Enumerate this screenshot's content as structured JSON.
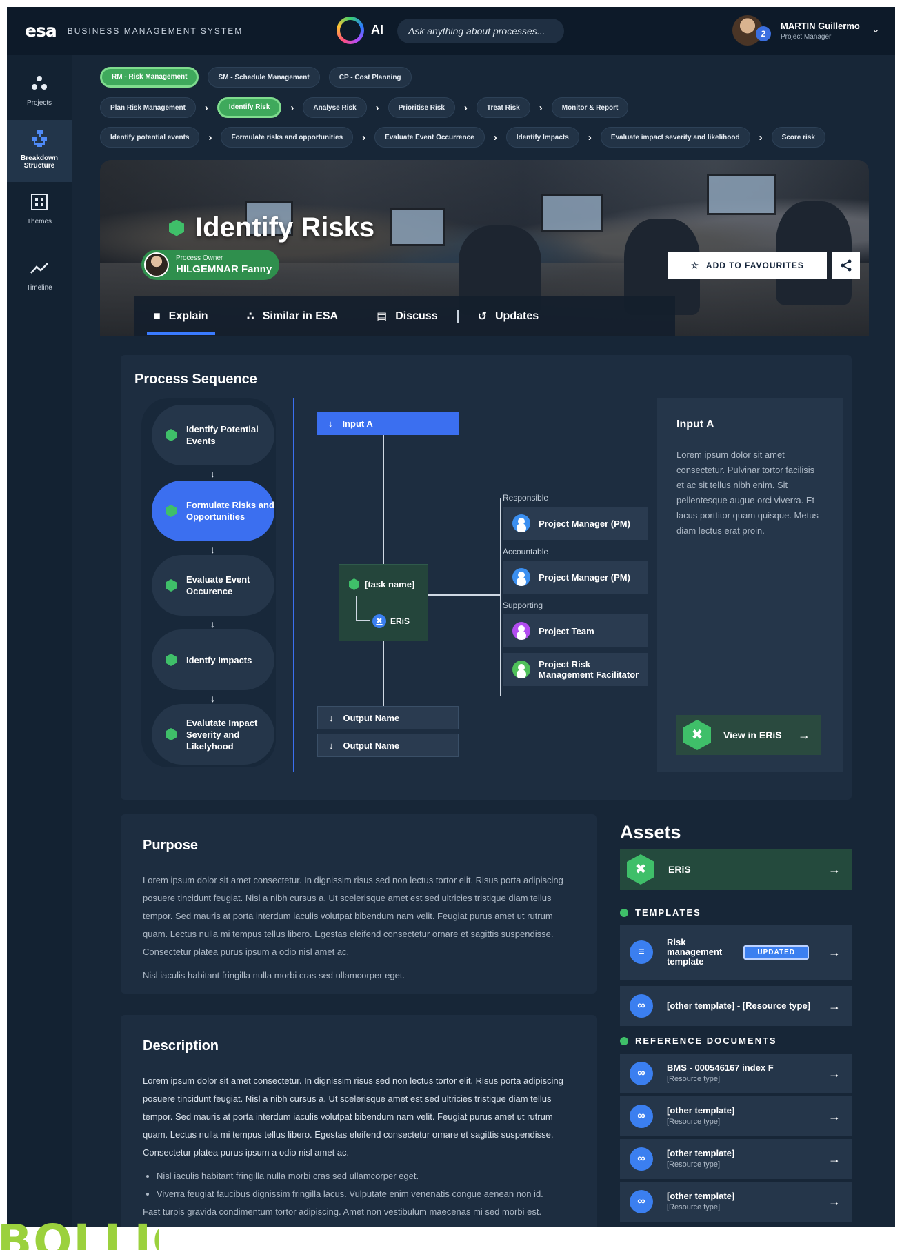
{
  "header": {
    "logo_text": "esa",
    "app_title": "BUSINESS MANAGEMENT SYSTEM",
    "ai_label": "AI",
    "ai_placeholder": "Ask anything about processes...",
    "user_name": "MARTIN Guillermo",
    "user_role": "Project Manager",
    "notification_count": "2"
  },
  "sidebar": {
    "items": [
      {
        "label": "Projects",
        "icon": "projects-icon"
      },
      {
        "label": "Breakdown Structure",
        "icon": "breakdown-icon"
      },
      {
        "label": "Themes",
        "icon": "themes-icon"
      },
      {
        "label": "Timeline",
        "icon": "timeline-icon"
      }
    ],
    "active_index": 1
  },
  "breadcrumbs": {
    "row1": [
      "RM - Risk Management",
      "SM - Schedule Management",
      "CP - Cost Planning"
    ],
    "row2": [
      "Plan Risk Management",
      "Identify Risk",
      "Analyse Risk",
      "Prioritise Risk",
      "Treat Risk",
      "Monitor & Report"
    ],
    "row3": [
      "Identify potential events",
      "Formulate risks and opportunities",
      "Evaluate Event Occurrence",
      "Identify Impacts",
      "Evaluate impact severity and likelihood",
      "Score risk"
    ]
  },
  "hero": {
    "title": "Identify Risks",
    "owner_label": "Process Owner",
    "owner_name": "HILGEMNAR Fanny",
    "favourite_label": "ADD TO FAVOURITES",
    "tabs": [
      "Explain",
      "Similar in ESA",
      "Discuss",
      "Updates"
    ]
  },
  "process": {
    "title": "Process Sequence",
    "steps": [
      "Identify Potential Events",
      "Formulate Risks and Opportunities",
      "Evaluate Event Occurence",
      "Identfy Impacts",
      "Evalutate Impact Severity and Likelyhood"
    ],
    "active_step": 1,
    "input": "Input A",
    "outputs": [
      "Output Name",
      "Output Name"
    ],
    "task_name": "[task name]",
    "task_tool": "ERiS",
    "roles": [
      {
        "label": "Responsible",
        "name": "Project Manager (PM)",
        "color": "#3b8ff0"
      },
      {
        "label": "Accountable",
        "name": "Project Manager (PM)",
        "color": "#3b8ff0"
      },
      {
        "label": "Supporting",
        "name": "Project Team",
        "color": "#b24cf0"
      },
      {
        "label": "",
        "name": "Project Risk Management Facilitator",
        "color": "#4fc05a"
      }
    ],
    "info_title": "Input A",
    "info_text": "Lorem ipsum dolor sit amet consectetur. Pulvinar tortor facilisis et ac sit tellus nibh enim. Sit pellentesque augue orci viverra. Et lacus porttitor quam quisque. Metus diam lectus erat proin.",
    "view_label": "View in ERiS"
  },
  "purpose": {
    "title": "Purpose",
    "p1": "Lorem ipsum dolor sit amet consectetur. In dignissim risus sed non lectus tortor elit. Risus porta adipiscing posuere tincidunt feugiat. Nisl a nibh cursus a. Ut scelerisque amet est sed ultricies tristique diam tellus tempor. Sed mauris at porta interdum iaculis volutpat bibendum nam velit. Feugiat purus amet ut rutrum quam. Lectus nulla mi tempus tellus libero. Egestas eleifend consectetur ornare et sagittis suspendisse. Consectetur platea purus ipsum a odio nisl amet ac.",
    "p2": "Nisl iaculis habitant fringilla nulla morbi cras sed ullamcorper eget."
  },
  "description": {
    "title": "Description",
    "p1_strong": "Lorem ipsum dolor sit amet consectetur. In dignissim risus sed non lectus tortor elit. Risus porta adipiscing posuere tincidunt feugiat. Nisl a nibh cursus a. Ut scelerisque amet est sed ultricies tristique diam tellus tempor. Sed mauris at porta interdum iaculis volutpat bibendum nam velit. Feugiat purus amet ut rutrum quam. Lectus nulla mi tempus tellus libero.",
    "p1_rest": " Egestas eleifend consectetur ornare et sagittis suspendisse. Consectetur platea purus ipsum a odio nisl amet ac.",
    "bullets": [
      "Nisl iaculis habitant fringilla nulla morbi cras sed ullamcorper eget.",
      "Viverra feugiat faucibus dignissim fringilla lacus. Vulputate enim venenatis congue aenean non id."
    ],
    "trailing": "Fast turpis gravida condimentum tortor adipiscing. Amet non vestibulum maecenas mi sed morbi est."
  },
  "assets": {
    "title": "Assets",
    "eris_label": "ERiS",
    "templates_label": "TEMPLATES",
    "templates": [
      {
        "name": "Risk management template",
        "badge": "UPDATED"
      },
      {
        "name": "[other template] - [Resource type]"
      }
    ],
    "refs_label": "REFERENCE DOCUMENTS",
    "refs": [
      {
        "name": "BMS - 000546167 index F",
        "type": "[Resource type]"
      },
      {
        "name": "[other template]",
        "type": "[Resource type]"
      },
      {
        "name": "[other template]",
        "type": "[Resource type]"
      },
      {
        "name": "[other template]",
        "type": "[Resource type]"
      }
    ]
  },
  "colors": {
    "background": "#172637",
    "accent_blue": "#3b6ff0",
    "accent_green": "#3fbf69",
    "bottom_logo": "#9bd13d"
  },
  "bottom_logo_text": "BOLLIC"
}
